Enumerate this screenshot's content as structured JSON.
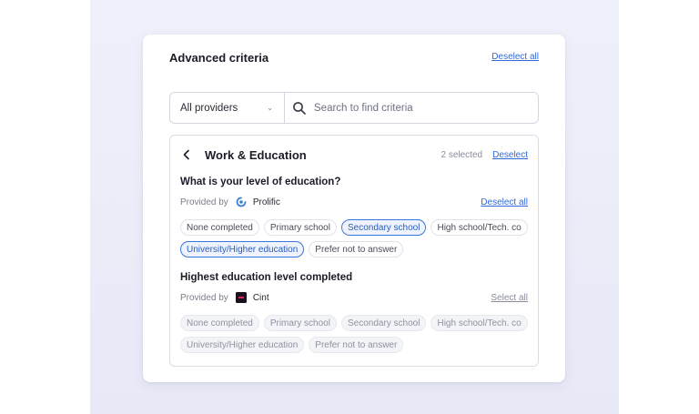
{
  "card": {
    "title": "Advanced criteria",
    "deselect_all": "Deselect all"
  },
  "filter": {
    "provider_selected": "All providers",
    "search_placeholder": "Search to find criteria"
  },
  "panel": {
    "title": "Work & Education",
    "selected_count": "2 selected",
    "deselect": "Deselect"
  },
  "sections": [
    {
      "question": "What is your level of education?",
      "provided_by_label": "Provided by",
      "provider_name": "Prolific",
      "provider_icon": "prolific-logo-icon",
      "action": "Deselect all",
      "chips": [
        {
          "label": "None completed",
          "selected": false
        },
        {
          "label": "Primary school",
          "selected": false
        },
        {
          "label": "Secondary school",
          "selected": true
        },
        {
          "label": "High school/Tech. co",
          "selected": false
        },
        {
          "label": "University/Higher education",
          "selected": true
        },
        {
          "label": "Prefer not to answer",
          "selected": false
        }
      ]
    },
    {
      "question": "Highest education level completed",
      "provided_by_label": "Provided by",
      "provider_name": "Cint",
      "provider_icon": "cint-logo-icon",
      "action": "Select all",
      "chips": [
        {
          "label": "None completed",
          "selected": false
        },
        {
          "label": "Primary school",
          "selected": false
        },
        {
          "label": "Secondary school",
          "selected": false
        },
        {
          "label": "High school/Tech. co",
          "selected": false
        },
        {
          "label": "University/Higher education",
          "selected": false
        },
        {
          "label": "Prefer not to answer",
          "selected": false
        }
      ]
    }
  ],
  "colors": {
    "accent": "#3369d6",
    "selected_border": "#3c74dc",
    "cint_brand": "#1a1020"
  }
}
